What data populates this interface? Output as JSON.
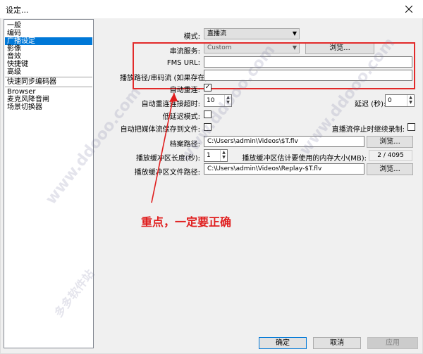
{
  "window": {
    "title": "设定..."
  },
  "sidebar": {
    "items": [
      {
        "label": "一般",
        "selected": false
      },
      {
        "label": "编码",
        "selected": false
      },
      {
        "label": "广播设定",
        "selected": true
      },
      {
        "label": "影像",
        "selected": false
      },
      {
        "label": "音效",
        "selected": false
      },
      {
        "label": "快捷键",
        "selected": false
      },
      {
        "label": "高级",
        "selected": false
      },
      {
        "label": "快速同步编码器",
        "selected": false
      },
      {
        "label": "Browser",
        "selected": false
      },
      {
        "label": "麦克风降音闸",
        "selected": false
      },
      {
        "label": "场景切换器",
        "selected": false
      }
    ]
  },
  "form": {
    "mode_label": "模式:",
    "mode_value": "直播流",
    "stream_service_label": "串流服务:",
    "stream_service_value": "Custom",
    "browse_label": "浏览...",
    "fms_url_label": "FMS URL:",
    "fms_url_value": "",
    "play_path_label": "播放路径/串码流 (如果存在):",
    "play_path_value": "",
    "auto_reconnect_label": "自动重连:",
    "auto_reconnect_checked": true,
    "reconnect_timeout_label": "自动重连连接超时:",
    "reconnect_timeout_value": "10",
    "delay_label": "延迟 (秒):",
    "delay_value": "0",
    "low_latency_label": "低延迟模式:",
    "low_latency_checked": false,
    "auto_save_label": "自动把媒体流保存到文件:",
    "auto_save_checked": false,
    "keep_recording_label": "直播流停止时继续录制:",
    "keep_recording_checked": false,
    "archive_path_label": "档案路径:",
    "archive_path_value": "C:\\Users\\admin\\Videos\\$T.flv",
    "replay_buffer_length_label": "播放缓冲区长度(秒):",
    "replay_buffer_length_value": "1",
    "replay_memory_label": "播放缓冲区估计要使用的内存大小(MB):",
    "replay_memory_value": "2 / 4095",
    "replay_path_label": "播放缓冲区文件路径:",
    "replay_path_value": "C:\\Users\\admin\\Videos\\Replay-$T.flv"
  },
  "buttons": {
    "ok": "确定",
    "cancel": "取消",
    "apply": "应用"
  },
  "annotation": {
    "text": "重点，一定要正确",
    "color": "#e01e1e"
  },
  "watermark": {
    "text": "www.ddooo.com",
    "text2": "多多软件站"
  },
  "colors": {
    "selection": "#0078d7",
    "highlight_box": "#e22a2a"
  }
}
